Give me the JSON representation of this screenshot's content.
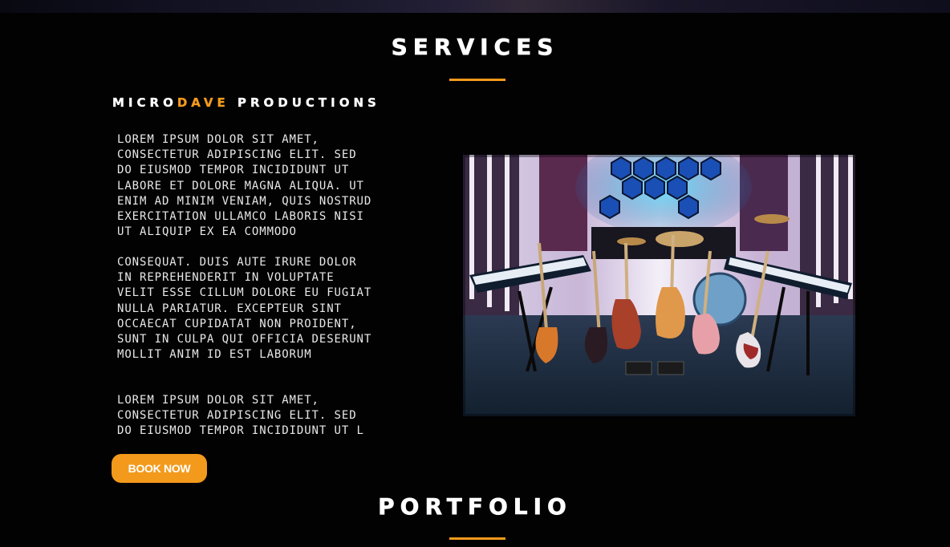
{
  "services": {
    "title": "SERVICES",
    "heading_part1": "MICRO",
    "heading_part2": "DAVE",
    "heading_part3": " PRODUCTIONS",
    "paragraph1": "LOREM IPSUM DOLOR SIT AMET,\nCONSECTETUR ADIPISCING ELIT. SED\nDO EIUSMOD TEMPOR INCIDIDUNT UT\nLABORE ET DOLORE MAGNA ALIQUA. UT\nENIM AD MINIM VENIAM, QUIS NOSTRUD\nEXERCITATION ULLAMCO LABORIS NISI\nUT ALIQUIP EX EA COMMODO",
    "paragraph2": " CONSEQUAT. DUIS AUTE IRURE DOLOR\nIN REPREHENDERIT IN VOLUPTATE\nVELIT ESSE CILLUM DOLORE EU FUGIAT\nNULLA PARIATUR. EXCEPTEUR SINT\nOCCAECAT CUPIDATAT NON PROIDENT,\nSUNT IN CULPA QUI OFFICIA DESERUNT\nMOLLIT ANIM ID EST LABORUM",
    "paragraph3": "LOREM IPSUM DOLOR SIT AMET,\nCONSECTETUR ADIPISCING ELIT. SED\nDO EIUSMOD TEMPOR INCIDIDUNT UT L",
    "button_label": "BOOK NOW"
  },
  "portfolio": {
    "title": "PORTFOLIO"
  },
  "colors": {
    "accent": "#f39a1c",
    "background": "#020203",
    "text": "#ffffff"
  }
}
